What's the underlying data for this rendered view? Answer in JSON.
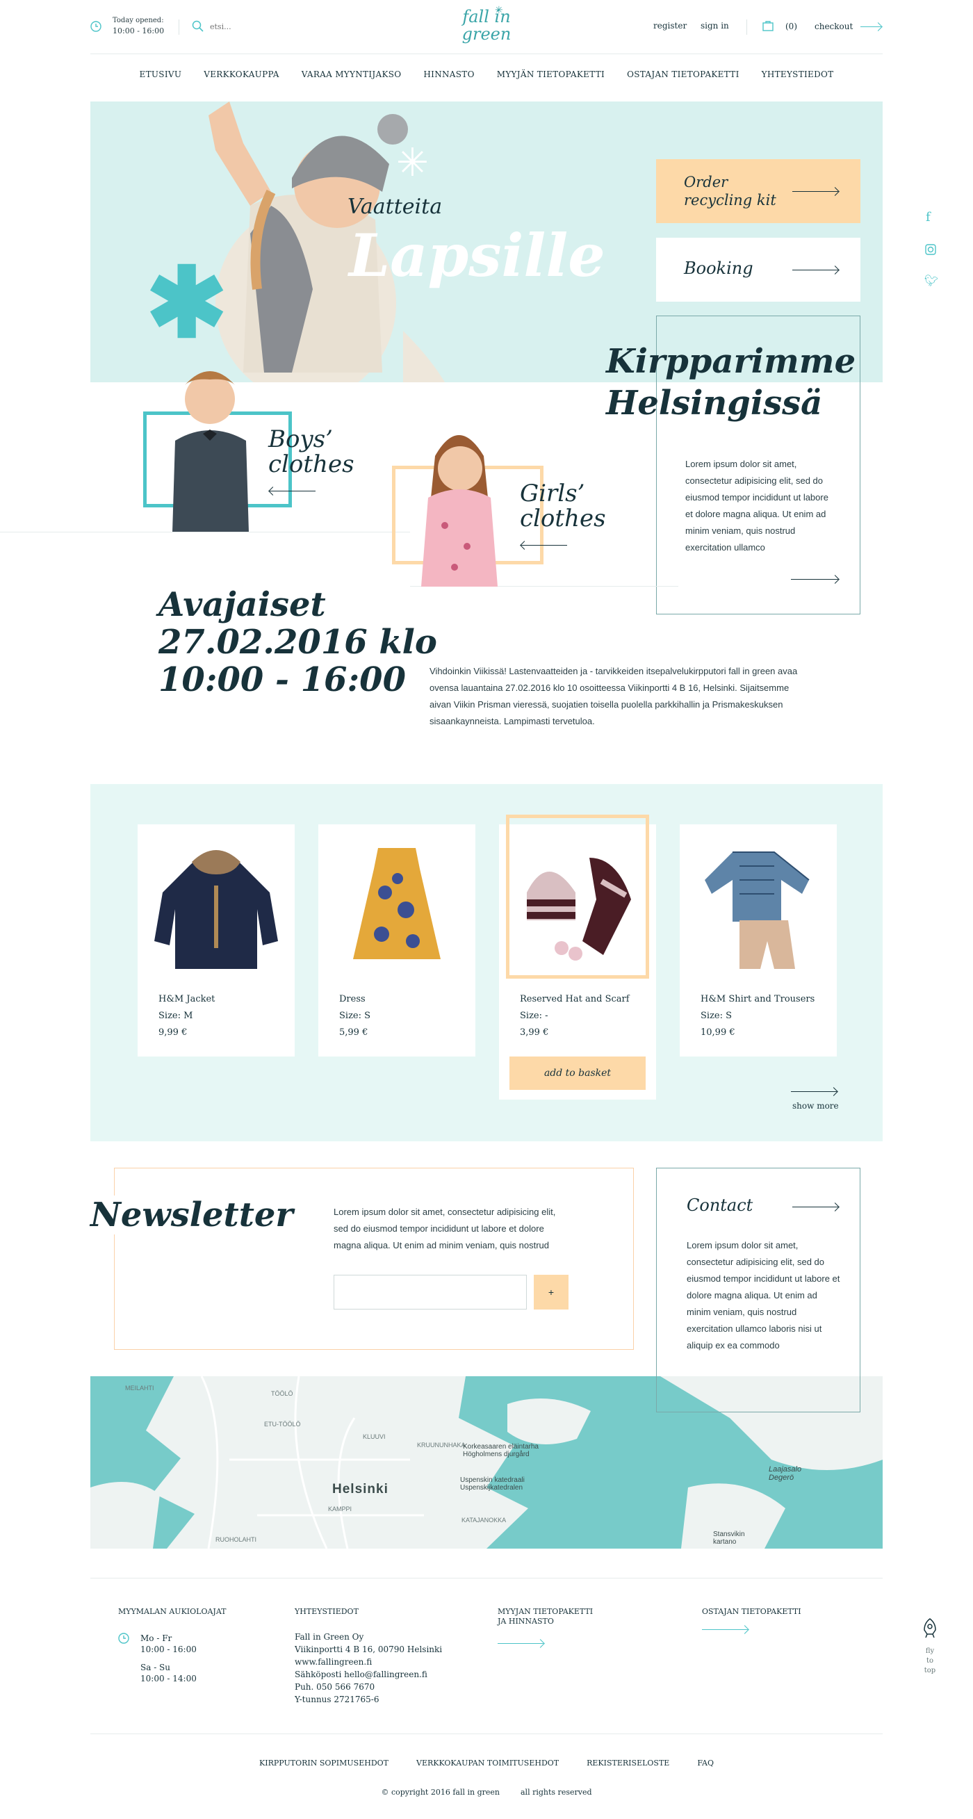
{
  "header": {
    "hours_label": "Today opened:",
    "hours_value": "10:00 - 16:00",
    "search_placeholder": "etsi...",
    "logo_line1": "fall in",
    "logo_line2": "green",
    "register": "register",
    "signin": "sign in",
    "cart_count": "(0)",
    "checkout": "checkout"
  },
  "nav": [
    "ETUSIVU",
    "VERKKOKAUPPA",
    "VARAA MYYNTIJAKSO",
    "HINNASTO",
    "MYYJÄN TIETOPAKETTI",
    "OSTAJAN TIETOPAKETTI",
    "YHTEYSTIEDOT"
  ],
  "hero": {
    "subtitle": "Vaatteita",
    "title": "Lapsille",
    "order_label": "Order recycling kit",
    "booking_label": "Booking"
  },
  "info": {
    "heading_line1": "Kirpparimme",
    "heading_line2": "Helsingissä",
    "text": "Lorem ipsum dolor sit amet, consectetur adipisicing elit, sed do eiusmod tempor incididunt ut labore et dolore magna aliqua. Ut enim ad minim veniam, quis nostrud exercitation ullamco"
  },
  "categories": {
    "boys_line1": "Boys’",
    "boys_line2": "clothes",
    "girls_line1": "Girls’",
    "girls_line2": "clothes"
  },
  "event": {
    "line1": "Avajaiset",
    "line2": "27.02.2016 klo",
    "line3": "10:00 - 16:00",
    "text": "Vihdoinkin Viikissä! Lastenvaatteiden ja - tarvikkeiden itsepalvelukirpputori fall in green avaa ovensa lauantaina 27.02.2016 klo 10 osoitteessa Viikinportti 4 B 16, Helsinki. Sijaitsemme aivan Viikin Prisman vieressä, suojatien toisella puolella parkkihallin ja Prismakeskuksen sisaankayn­neista. Lampimasti tervetuloa."
  },
  "products": [
    {
      "name": "H&M Jacket",
      "size": "Size: M",
      "price": "9,99 €"
    },
    {
      "name": "Dress",
      "size": "Size: S",
      "price": "5,99 €"
    },
    {
      "name": "Reserved Hat and Scarf",
      "size": "Size: -",
      "price": "3,99 €"
    },
    {
      "name": "H&M Shirt and Trousers",
      "size": "Size: S",
      "price": "10,99 €"
    }
  ],
  "add_to_basket": "add to basket",
  "show_more": "show more",
  "newsletter": {
    "title": "Newsletter",
    "text": "Lorem ipsum dolor sit amet, consectetur adipisicing elit, sed do eiusmod tempor incididunt ut labore et dolore magna aliqua. Ut enim ad minim veniam, quis nostrud",
    "submit": "+"
  },
  "contact": {
    "title": "Contact",
    "text": "Lorem ipsum dolor sit amet, consectetur adipisicing elit, sed do eiusmod tempor incididunt ut labore et dolore magna aliqua. Ut enim ad minim veniam, quis nostrud exercitation ullamco laboris nisi ut aliquip ex ea commodo"
  },
  "map": {
    "labels": [
      "MEILAHTI",
      "TÖÖLÖ",
      "KLUUVI",
      "ETU-TÖÖLÖ",
      "KRUUNUNHAKA",
      "Korkeasaaren eläintarha Högholmens djurgård",
      "Helsinki",
      "Uspenskin katedraali Uspenskijkatedralen",
      "KAMPPI",
      "KATAJANOKKA",
      "RUOHOLAHTI",
      "Laajasalo Degerö",
      "Stansvikin kartano"
    ]
  },
  "footer": {
    "col1_title": "MYYMALAN AUKIOLOAJAT",
    "col1_days1": "Mo - Fr",
    "col1_hours1": "10:00 - 16:00",
    "col1_days2": "Sa - Su",
    "col1_hours2": "10:00 - 14:00",
    "col2_title": "YHTEYSTIEDOT",
    "col2_lines": [
      "Fall in Green Oy",
      "Viikinportti 4 B 16, 00790 Helsinki",
      "www.fallingreen.fi",
      "Sähköposti hello@fallingreen.fi",
      "Puh. 050 566 7670",
      "Y-tunnus 2721765-6"
    ],
    "col3_title_line1": "MYYJAN TIETOPAKETTI",
    "col3_title_line2": "JA HINNASTO",
    "col4_title": "OSTAJAN TIETOPAKETTI",
    "links": [
      "KIRPPUTORIN SOPIMUSEHDOT",
      "VERKKOKAUPAN TOIMITUSEHDOT",
      "REKISTERISELOSTE",
      "FAQ"
    ],
    "copyright": "© copyright 2016 fall in green",
    "rights": "all rights reserved",
    "fly_line1": "fly",
    "fly_line2": "to",
    "fly_line3": "top"
  },
  "colors": {
    "teal": "#4cc4c8",
    "mint": "#e6f7f5",
    "peach": "#fdd9a8",
    "dark": "#17323a"
  }
}
